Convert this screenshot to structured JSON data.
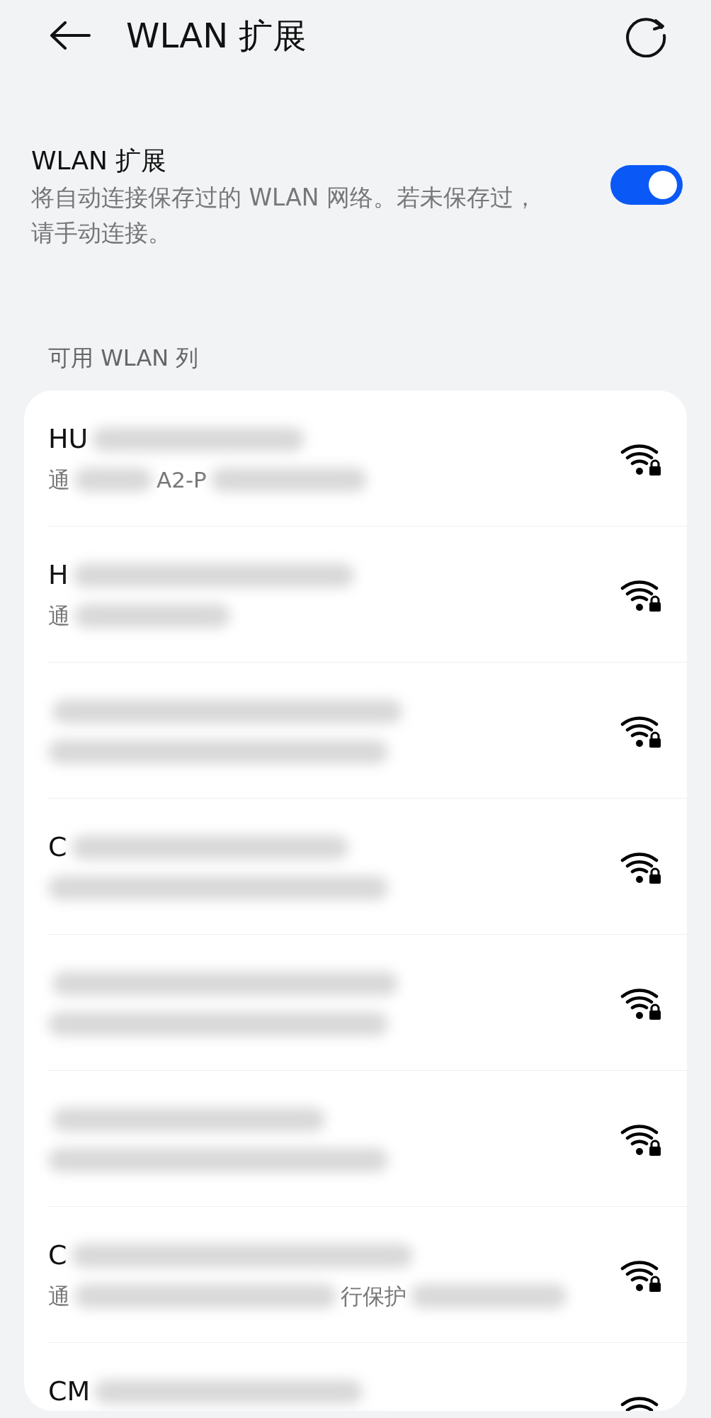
{
  "header": {
    "title": "WLAN 扩展"
  },
  "setting": {
    "title": "WLAN 扩展",
    "description": "将自动连接保存过的 WLAN 网络。若未保存过，请手动连接。",
    "on": true
  },
  "section": {
    "title": "可用 WLAN 列"
  },
  "networks": [
    {
      "name": "HU",
      "detail": [
        "通",
        "A2-P"
      ],
      "locked": true
    },
    {
      "name": "H",
      "detail": [
        "通"
      ],
      "locked": true
    },
    {
      "locked": true
    },
    {
      "name": "C",
      "locked": true
    },
    {
      "locked": true
    },
    {
      "locked": true
    },
    {
      "name": "C",
      "detail": [
        "通",
        "行保护"
      ],
      "locked": true
    },
    {
      "name": "CM"
    }
  ]
}
